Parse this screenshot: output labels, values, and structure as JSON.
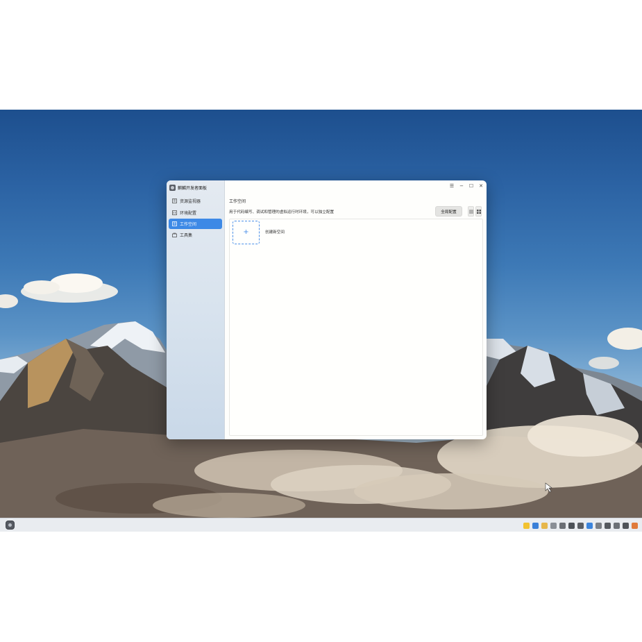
{
  "window": {
    "app_title": "麒麟开发者面板",
    "controls": {
      "menu": "☰",
      "minimize": "−",
      "maximize": "☐",
      "close": "✕"
    }
  },
  "sidebar": {
    "items": [
      {
        "label": "资源监视器",
        "icon": "monitor-icon",
        "active": false
      },
      {
        "label": "环境配置",
        "icon": "config-icon",
        "active": false
      },
      {
        "label": "工作空间",
        "icon": "workspace-icon",
        "active": true
      },
      {
        "label": "工具集",
        "icon": "toolbox-icon",
        "active": false
      }
    ]
  },
  "main": {
    "section_title": "工作空间",
    "section_desc": "用于代码编写、调试和管理的虚拟运行时环境，可以独立配置",
    "global_config_label": "全局配置",
    "view_buttons": [
      "list-view-icon",
      "grid-view-icon"
    ],
    "create_card": {
      "plus": "+",
      "label": "创建新空间"
    }
  },
  "taskbar": {
    "tray_icons": [
      "star-icon",
      "network-icon",
      "folder-icon",
      "camera-icon",
      "chat-icon",
      "shield-icon",
      "share-icon",
      "app-icon",
      "chevron-icon",
      "headset-icon",
      "input-icon",
      "volume-icon",
      "power-icon"
    ]
  },
  "colors": {
    "accent": "#3d89e6",
    "sidebar": "#d8e3ee",
    "window_bg": "#fefefc"
  }
}
